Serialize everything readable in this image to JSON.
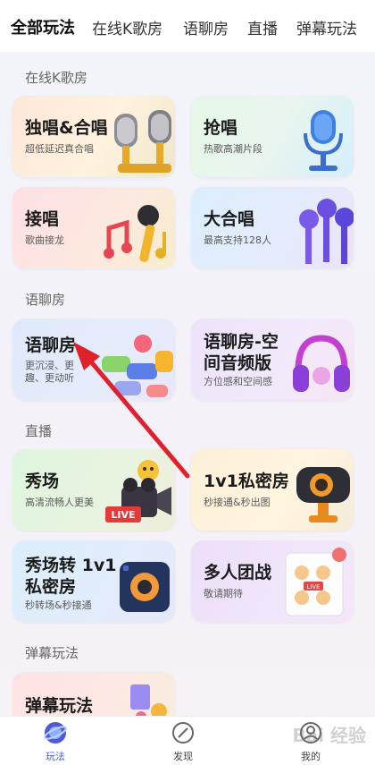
{
  "tabs": [
    "全部玩法",
    "在线K歌房",
    "语聊房",
    "直播",
    "弹幕玩法"
  ],
  "sections": {
    "ktv": "在线K歌房",
    "voice": "语聊房",
    "live": "直播",
    "danmaku": "弹幕玩法"
  },
  "cards": {
    "solo": {
      "title": "独唱&合唱",
      "sub": "超低延迟真合唱"
    },
    "grab": {
      "title": "抢唱",
      "sub": "热歌高潮片段"
    },
    "relay": {
      "title": "接唱",
      "sub": "歌曲接龙"
    },
    "choir": {
      "title": "大合唱",
      "sub": "最高支持128人"
    },
    "voice": {
      "title": "语聊房",
      "sub1": "更沉浸、更",
      "sub2": "趣、更动听"
    },
    "space": {
      "title1": "语聊房-空",
      "title2": "间音频版",
      "sub": "方位感和空间感"
    },
    "show": {
      "title": "秀场",
      "sub": "高清流畅人更美"
    },
    "private": {
      "title": "1v1私密房",
      "sub": "秒接通&秒出图"
    },
    "show1v1": {
      "title1": "秀场转 1v1",
      "title2": "私密房",
      "sub": "秒转场&秒接通"
    },
    "group": {
      "title": "多人团战",
      "sub": "敬请期待"
    },
    "danmaku": {
      "title": "弹幕玩法"
    }
  },
  "art_text": {
    "live_sign": "LIVE",
    "live_badge": "LIVE"
  },
  "nav": {
    "play": "玩法",
    "discover": "发现",
    "mine": "我的"
  },
  "watermark": "Bai 经验",
  "colors": {
    "accent": "#4a5cd6",
    "arrow": "#e0202a"
  }
}
